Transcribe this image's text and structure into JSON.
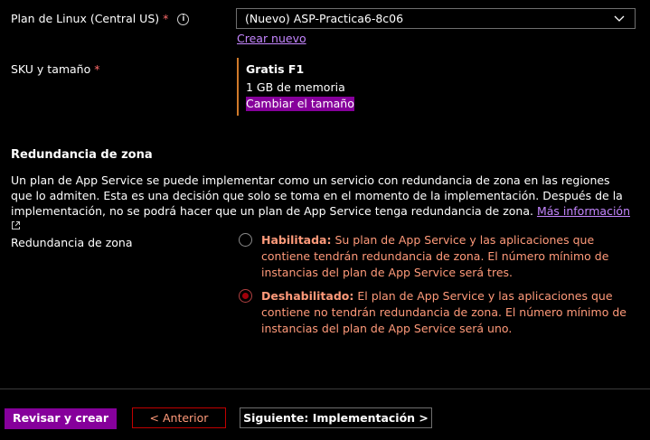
{
  "plan": {
    "label": "Plan de Linux (Central US)",
    "required_mark": "*",
    "info_icon": "i",
    "selected_value": "(Nuevo) ASP-Practica6-8c06",
    "create_new_link": "Crear nuevo"
  },
  "sku": {
    "label": "SKU y tamaño",
    "required_mark": "*",
    "tier": "Gratis F1",
    "memory": "1 GB de memoria",
    "change_size_link": "Cambiar el tamaño"
  },
  "zone_redundancy": {
    "section_title": "Redundancia de zona",
    "description": "Un plan de App Service se puede implementar como un servicio con redundancia de zona en las regiones que lo admiten. Esta es una decisión que solo se toma en el momento de la implementación. Después de la implementación, no se podrá hacer que un plan de App Service tenga redundancia de zona.",
    "more_info_link": "Más información",
    "field_label": "Redundancia de zona",
    "options": [
      {
        "title": "Habilitada:",
        "text": " Su plan de App Service y las aplicaciones que contiene tendrán redundancia de zona. El número mínimo de instancias del plan de App Service será tres.",
        "checked": false
      },
      {
        "title": "Deshabilitado:",
        "text": " El plan de App Service y las aplicaciones que contiene no tendrán redundancia de zona. El número mínimo de instancias del plan de App Service será uno.",
        "checked": true
      }
    ]
  },
  "footer": {
    "review_create": "Revisar y crear",
    "previous": "< Anterior",
    "next": "Siguiente: Implementación >"
  },
  "colors": {
    "accent": "#86009b",
    "link": "#c586ff",
    "warning_text": "#ff9a7a",
    "required": "#ff6b6b"
  }
}
